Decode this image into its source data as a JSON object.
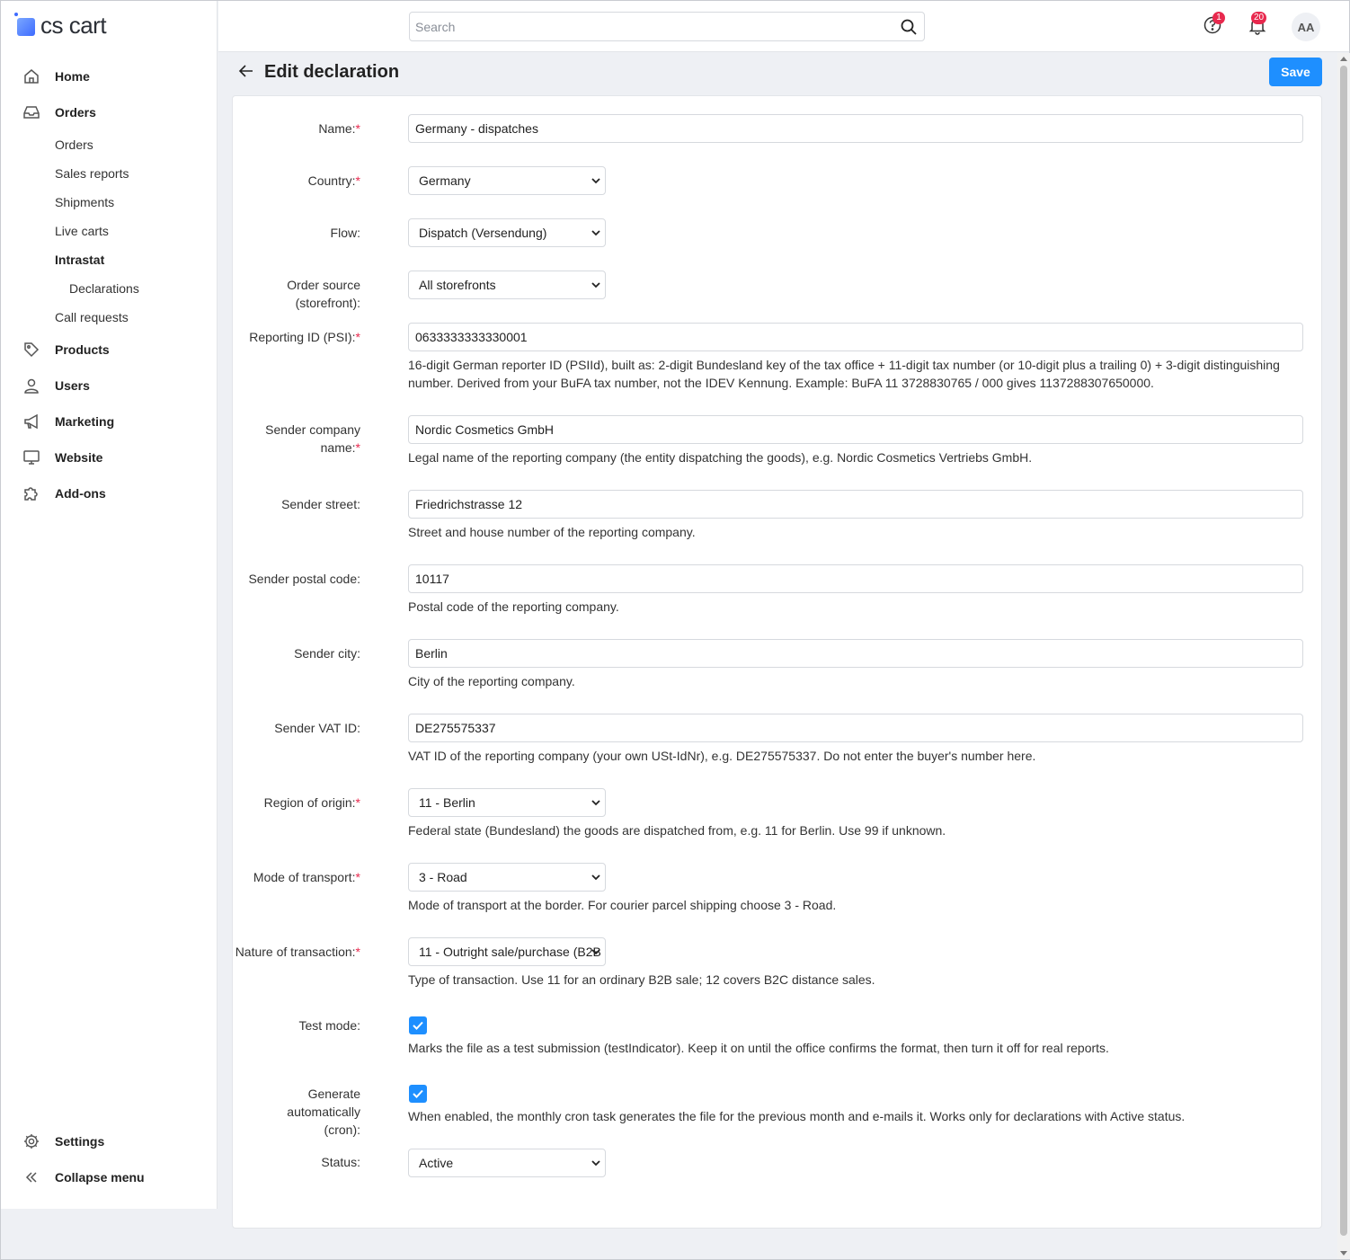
{
  "app": {
    "logo_text": "cs cart"
  },
  "sidebar": {
    "items": [
      {
        "label": "Home",
        "icon": "home-icon"
      },
      {
        "label": "Orders",
        "icon": "inbox-icon"
      },
      {
        "label": "Products",
        "icon": "tag-icon"
      },
      {
        "label": "Users",
        "icon": "user-icon"
      },
      {
        "label": "Marketing",
        "icon": "megaphone-icon"
      },
      {
        "label": "Website",
        "icon": "monitor-icon"
      },
      {
        "label": "Add-ons",
        "icon": "puzzle-icon"
      }
    ],
    "orders_sub": [
      "Orders",
      "Sales reports",
      "Shipments",
      "Live carts",
      "Intrastat",
      "Declarations",
      "Call requests"
    ],
    "settings_label": "Settings",
    "collapse_label": "Collapse menu"
  },
  "topbar": {
    "search_placeholder": "Search",
    "help_badge": "1",
    "notifications_badge": "20",
    "avatar_initials": "AA"
  },
  "page": {
    "title": "Edit declaration",
    "save_label": "Save"
  },
  "form": {
    "required_mark": "*",
    "name": {
      "label": "Name:",
      "value": "Germany - dispatches"
    },
    "country": {
      "label": "Country:",
      "value": "Germany"
    },
    "flow": {
      "label": "Flow:",
      "value": "Dispatch (Versendung)"
    },
    "order_source": {
      "label": "Order source (storefront):",
      "value": "All storefronts"
    },
    "reporting_id": {
      "label": "Reporting ID (PSI):",
      "value": "0633333333330001",
      "help": "16-digit German reporter ID (PSIId), built as: 2-digit Bundesland key of the tax office + 11-digit tax number (or 10-digit plus a trailing 0) + 3-digit distinguishing number. Derived from your BuFA tax number, not the IDEV Kennung. Example: BuFA 11 3728830765 / 000 gives 1137288307650000."
    },
    "sender_company": {
      "label": "Sender company name:",
      "value": "Nordic Cosmetics GmbH",
      "help": "Legal name of the reporting company (the entity dispatching the goods), e.g. Nordic Cosmetics Vertriebs GmbH."
    },
    "sender_street": {
      "label": "Sender street:",
      "value": "Friedrichstrasse 12",
      "help": "Street and house number of the reporting company."
    },
    "sender_postal": {
      "label": "Sender postal code:",
      "value": "10117",
      "help": "Postal code of the reporting company."
    },
    "sender_city": {
      "label": "Sender city:",
      "value": "Berlin",
      "help": "City of the reporting company."
    },
    "sender_vat": {
      "label": "Sender VAT ID:",
      "value": "DE275575337",
      "help": "VAT ID of the reporting company (your own USt-IdNr), e.g. DE275575337. Do not enter the buyer's number here."
    },
    "region": {
      "label": "Region of origin:",
      "value": "11 - Berlin",
      "help": "Federal state (Bundesland) the goods are dispatched from, e.g. 11 for Berlin. Use 99 if unknown."
    },
    "transport": {
      "label": "Mode of transport:",
      "value": "3 - Road",
      "help": "Mode of transport at the border. For courier parcel shipping choose 3 - Road."
    },
    "transaction": {
      "label": "Nature of transaction:",
      "value": "11 - Outright sale/purchase (B2B",
      "help": "Type of transaction. Use 11 for an ordinary B2B sale; 12 covers B2C distance sales."
    },
    "test_mode": {
      "label": "Test mode:",
      "checked": true,
      "help": "Marks the file as a test submission (testIndicator). Keep it on until the office confirms the format, then turn it off for real reports."
    },
    "auto_generate": {
      "label_line1": "Generate automatically",
      "label_line2": "(cron):",
      "checked": true,
      "help": "When enabled, the monthly cron task generates the file for the previous month and e-mails it. Works only for declarations with Active status."
    },
    "status": {
      "label": "Status:",
      "value": "Active"
    }
  },
  "colors": {
    "accent": "#1e8fff",
    "badge": "#e8294e",
    "background": "#eef0f4"
  }
}
